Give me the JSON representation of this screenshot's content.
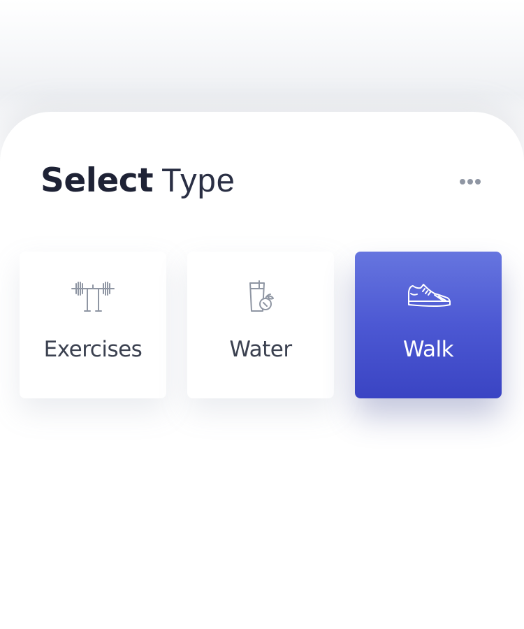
{
  "header": {
    "title_bold": "Select",
    "title_light": "Type",
    "more_icon": "more-horizontal-icon"
  },
  "types": [
    {
      "label": "Exercises",
      "icon": "barbell-icon",
      "selected": false
    },
    {
      "label": "Water",
      "icon": "water-glass-icon",
      "selected": false
    },
    {
      "label": "Walk",
      "icon": "sneaker-icon",
      "selected": true
    }
  ],
  "colors": {
    "accent": "#4c58d3",
    "accent_light": "#6675df",
    "accent_dark": "#3a44c3",
    "title": "#1e2235",
    "label": "#3b4150",
    "icon_gray": "#8f96a3"
  }
}
